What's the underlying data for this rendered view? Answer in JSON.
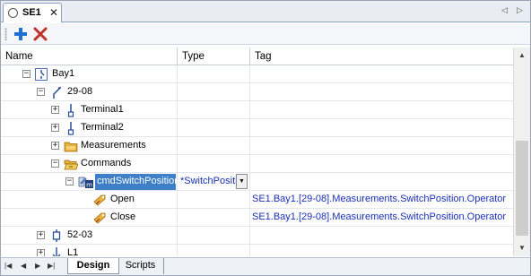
{
  "document_tab": {
    "label": "SE1",
    "close_glyph": "✕"
  },
  "nav_arrows": {
    "prev": "◁",
    "next": "▷"
  },
  "toolbar": {
    "add_icon": "plus-icon",
    "delete_icon": "delete-icon",
    "add_color": "#1e6fd0",
    "delete_color": "#c0302a"
  },
  "columns": {
    "name": "Name",
    "type": "Type",
    "tag": "Tag"
  },
  "rows": [
    {
      "id": "bay1",
      "label": "Bay1",
      "expander": "−",
      "icon": "bay-icon"
    },
    {
      "id": "29-08",
      "label": "29-08",
      "expander": "−",
      "icon": "switch-icon"
    },
    {
      "id": "terminal1",
      "label": "Terminal1",
      "expander": "+",
      "icon": "terminal-icon"
    },
    {
      "id": "terminal2",
      "label": "Terminal2",
      "expander": "+",
      "icon": "terminal-icon"
    },
    {
      "id": "measurements",
      "label": "Measurements",
      "expander": "+",
      "icon": "folder-icon"
    },
    {
      "id": "commands",
      "label": "Commands",
      "expander": "−",
      "icon": "folder-open-icon"
    },
    {
      "id": "cmdSwitchPosition",
      "label": "cmdSwitchPosition",
      "expander": "−",
      "icon": "command-icon",
      "type": "*SwitchPosition",
      "selected": true
    },
    {
      "id": "open",
      "label": "Open",
      "icon": "operator-icon",
      "tag": "SE1.Bay1.[29-08].Measurements.SwitchPosition.Operator"
    },
    {
      "id": "close",
      "label": "Close",
      "icon": "operator-icon",
      "tag": "SE1.Bay1.[29-08].Measurements.SwitchPosition.Operator"
    },
    {
      "id": "52-03",
      "label": "52-03",
      "expander": "+",
      "icon": "breaker-icon"
    },
    {
      "id": "L1",
      "label": "L1",
      "expander": "+",
      "icon": "line-icon"
    }
  ],
  "scrollbar": {
    "up": "▲",
    "down": "▼"
  },
  "bottom_tabs": {
    "nav_first": "|◀",
    "nav_prev": "◀",
    "nav_next": "▶",
    "nav_last": "▶|",
    "design": "Design",
    "scripts": "Scripts"
  },
  "colors": {
    "selection": "#3e7fc8",
    "tag_text": "#1a2fb8",
    "accent_border": "#8fa3c0"
  }
}
